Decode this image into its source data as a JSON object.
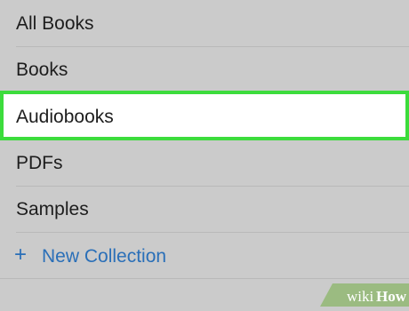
{
  "collections": {
    "items": [
      {
        "label": "All Books"
      },
      {
        "label": "Books"
      },
      {
        "label": "Audiobooks",
        "selected": true
      },
      {
        "label": "PDFs"
      },
      {
        "label": "Samples"
      }
    ],
    "new_collection_label": "New Collection"
  },
  "watermark": {
    "text_wiki": "wiki",
    "text_how": "How"
  },
  "colors": {
    "background": "#cbcbcb",
    "highlight_border": "#3cdc3c",
    "link": "#2a6fb8"
  }
}
